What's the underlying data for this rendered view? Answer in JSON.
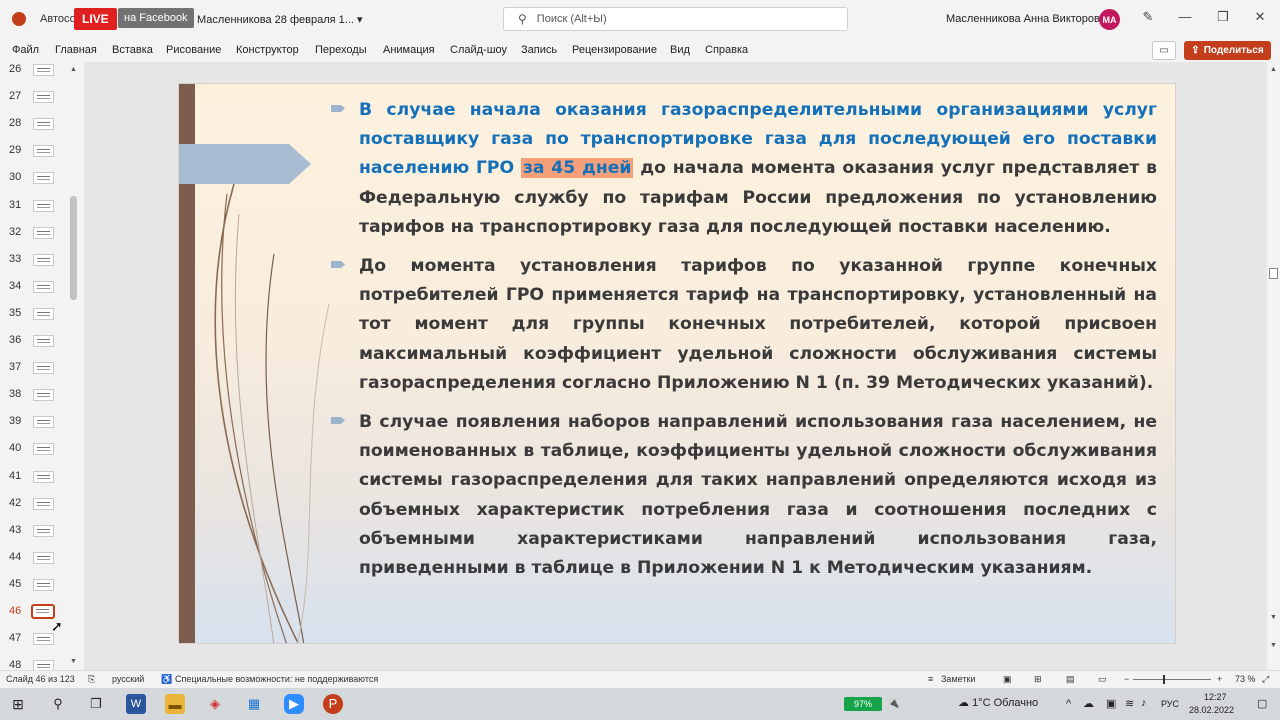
{
  "titlebar": {
    "autosave": "Автосох",
    "live": "LIVE",
    "facebook": "на Facebook",
    "doc_title": "Масленникова 28 февраля 1...",
    "search_placeholder": "Поиск (Alt+Ы)",
    "username": "Масленникова Анна Викторовна",
    "avatar_initials": "МА"
  },
  "menu": [
    "Файл",
    "Главная",
    "Вставка",
    "Рисование",
    "Конструктор",
    "Переходы",
    "Анимация",
    "Слайд-шоу",
    "Запись",
    "Рецензирование",
    "Вид",
    "Справка"
  ],
  "share_label": "Поделиться",
  "thumbnails": [
    "26",
    "27",
    "28",
    "29",
    "30",
    "31",
    "32",
    "33",
    "34",
    "35",
    "36",
    "37",
    "38",
    "39",
    "40",
    "41",
    "42",
    "43",
    "44",
    "45",
    "46",
    "47",
    "48"
  ],
  "active_slide": "46",
  "slide": {
    "bullet1_blue": "В случае начала оказания газораспределительными организациями услуг поставщику газа по транспортировке газа для последующей его поставки населению ГРО",
    "bullet1_highlight": "за 45 дней",
    "bullet1_rest": "до начала момента оказания услуг представляет в Федеральную службу по тарифам России предложения по установлению тарифов на транспортировку газа для последующей поставки населению.",
    "bullet2": "До момента установления тарифов по указанной группе конечных потребителей ГРО применяется тариф на транспортировку, установленный на тот момент для группы конечных потребителей, которой присвоен максимальный коэффициент удельной сложности обслуживания системы газораспределения согласно Приложению N 1 (п. 39 Методических указаний).",
    "bullet3": "В случае появления наборов направлений использования газа населением, не поименованных в таблице, коэффициенты удельной сложности обслуживания системы газораспределения для таких направлений определяются исходя из объемных характеристик потребления газа и соотношения последних с объемными характеристиками направлений использования газа, приведенными в таблице в Приложении N 1 к Методическим указаниям."
  },
  "status": {
    "slide_count": "Слайд 46 из 123",
    "language": "русский",
    "accessibility": "Специальные возможности: не поддерживаются",
    "notes": "Заметки",
    "zoom": "73 %"
  },
  "taskbar": {
    "battery": "97%",
    "weather": "1°C Облачно",
    "lang": "РУС",
    "time": "12:27",
    "date": "28.02.2022"
  },
  "colors": {
    "accent": "#c43e1c",
    "blue_text": "#1470b8",
    "highlight": "#f4a07a",
    "stripe": "#7a5d4c"
  }
}
